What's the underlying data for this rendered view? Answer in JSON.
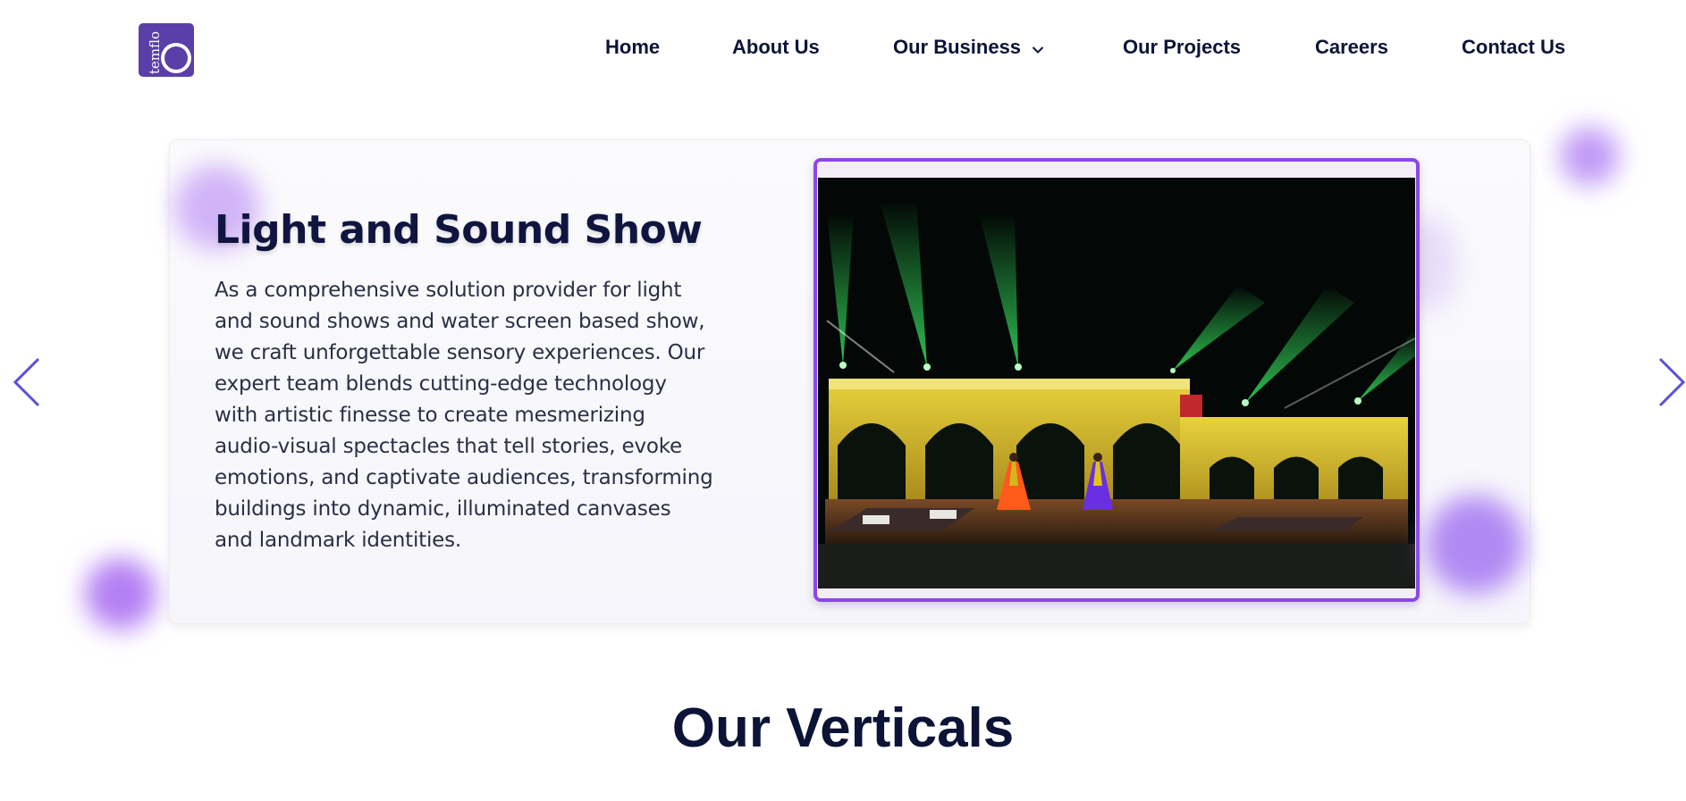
{
  "header": {
    "logo_text": "temflo",
    "nav": [
      {
        "label": "Home"
      },
      {
        "label": "About Us"
      },
      {
        "label": "Our Business",
        "has_dropdown": true
      },
      {
        "label": "Our Projects"
      },
      {
        "label": "Careers"
      },
      {
        "label": "Contact Us"
      }
    ]
  },
  "slide": {
    "title": "Light and Sound Show",
    "description": "As a comprehensive solution provider for light and sound shows and water screen based show, we craft unforgettable sensory experiences. Our expert team blends cutting-edge technology with artistic finesse to create mesmerizing audio-visual spectacles that tell stories, evoke emotions, and captivate audiences, transforming buildings into dynamic, illuminated canvases and landmark identities.",
    "image_icon": "light-show-photo"
  },
  "carousel": {
    "prev_icon": "chevron-left-icon",
    "next_icon": "chevron-right-icon"
  },
  "section": {
    "heading": "Our Verticals"
  },
  "colors": {
    "navy": "#0b1437",
    "brand_purple": "#5b3fa8",
    "frame_purple": "#8b47ea",
    "arrow_blue": "#5b4fd8",
    "blob_purple": "#b583f2"
  }
}
